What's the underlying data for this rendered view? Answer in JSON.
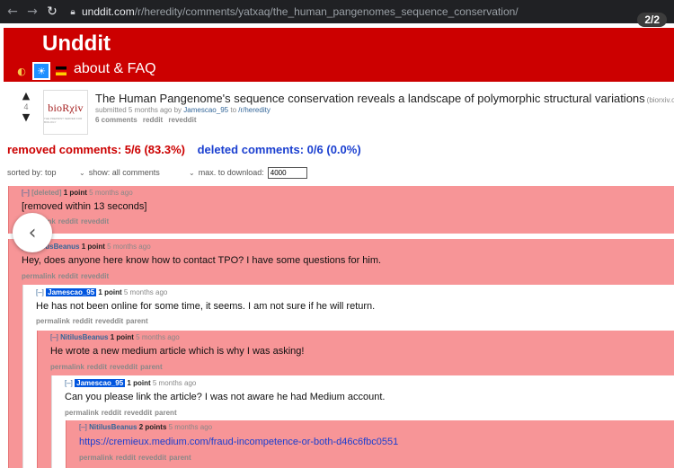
{
  "browser": {
    "url_host": "unddit.com",
    "url_path": "/r/heredity/comments/yatxaq/the_human_pangenomes_sequence_conservation/",
    "page_counter": "2/2"
  },
  "header": {
    "site_title": "Unddit",
    "about_label": "about & FAQ",
    "bg_color": "#cc0000"
  },
  "post": {
    "score": "4",
    "thumb_logo": "bioRχiv",
    "thumb_sub": "THE PREPRINT SERVER FOR BIOLOGY",
    "title": "The Human Pangenome's sequence conservation reveals a landscape of polymorphic structural variations",
    "domain": "(biorxiv.org)",
    "meta_prefix": "submitted 5 months ago by",
    "author": "Jamescao_95",
    "meta_to": "to",
    "subreddit": "/r/heredity",
    "links": [
      "6 comments",
      "reddit",
      "reveddit"
    ]
  },
  "stats": {
    "removed": "removed comments: 5/6 (83.3%)",
    "deleted": "deleted comments: 0/6 (0.0%)"
  },
  "controls": {
    "sorted": "sorted by: top",
    "show": "show: all comments",
    "max_label": "max. to download:",
    "max_value": "4000"
  },
  "comments": [
    {
      "toggle": "[–]",
      "author": "[deleted]",
      "points": "1 point",
      "time": "5 months ago",
      "body": "[removed within 13 seconds]",
      "links": [
        "permalink",
        "reddit",
        "reveddit"
      ]
    },
    {
      "toggle": "[–]",
      "author": "NitilusBeanus",
      "points": "1 point",
      "time": "5 months ago",
      "body": "Hey, does anyone here know how to contact TPO? I have some questions for him.",
      "links": [
        "permalink",
        "reddit",
        "reveddit"
      ]
    },
    {
      "toggle": "[–]",
      "author": "Jamescao_95",
      "points": "1 point",
      "time": "5 months ago",
      "body": "He has not been online for some time, it seems. I am not sure if he will return.",
      "links": [
        "permalink",
        "reddit",
        "reveddit",
        "parent"
      ]
    },
    {
      "toggle": "[–]",
      "author": "NitilusBeanus",
      "points": "1 point",
      "time": "5 months ago",
      "body": "He wrote a new medium article which is why I was asking!",
      "links": [
        "permalink",
        "reddit",
        "reveddit",
        "parent"
      ]
    },
    {
      "toggle": "[–]",
      "author": "Jamescao_95",
      "points": "1 point",
      "time": "5 months ago",
      "body": "Can you please link the article? I was not aware he had Medium account.",
      "links": [
        "permalink",
        "reddit",
        "reveddit",
        "parent"
      ]
    },
    {
      "toggle": "[–]",
      "author": "NitilusBeanus",
      "points": "2 points",
      "time": "5 months ago",
      "body": "https://cremieux.medium.com/fraud-incompetence-or-both-d46c6fbc0551",
      "links": [
        "permalink",
        "reddit",
        "reveddit",
        "parent"
      ]
    }
  ]
}
